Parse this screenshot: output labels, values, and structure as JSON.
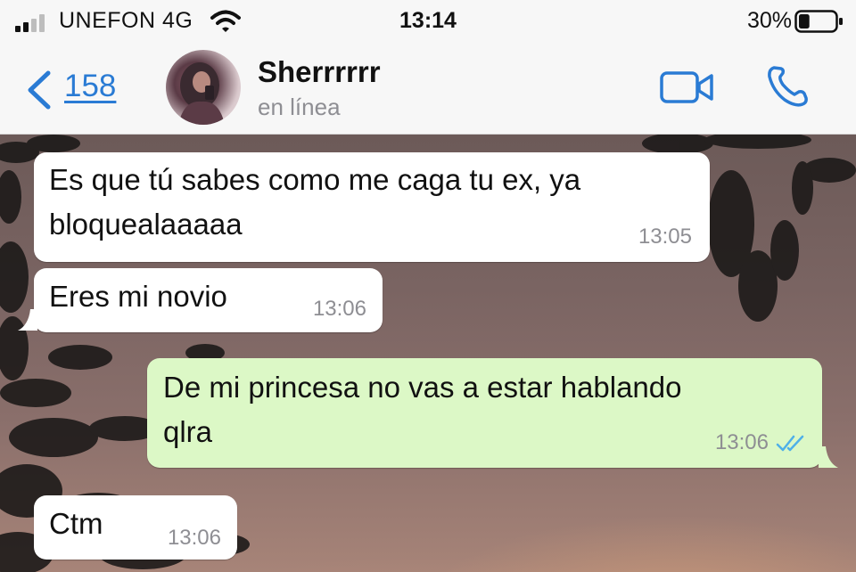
{
  "status_bar": {
    "carrier": "UNEFON 4G",
    "time": "13:14",
    "battery_percent": "30%",
    "battery_level": 0.3,
    "signal_bars": 2
  },
  "header": {
    "back_count": "158",
    "contact_name": "Sherrrrrr",
    "contact_status": "en línea",
    "icons": [
      "back-chevron-icon",
      "video-call-icon",
      "phone-call-icon"
    ]
  },
  "messages": [
    {
      "direction": "incoming",
      "text": "Es que tú sabes como me caga tu ex, ya\nbloquealaaaaa",
      "time": "13:05"
    },
    {
      "direction": "incoming",
      "text": "Eres mi novio",
      "time": "13:06"
    },
    {
      "direction": "outgoing",
      "text": "De mi princesa no vas a estar hablando\nqlra",
      "time": "13:06",
      "read": true
    },
    {
      "direction": "incoming",
      "text": "Ctm",
      "time": "13:06"
    }
  ],
  "colors": {
    "accent": "#2a7bd4",
    "outgoing_bubble": "#dcf8c6",
    "incoming_bubble": "#ffffff",
    "read_ticks": "#4fb0e8"
  }
}
